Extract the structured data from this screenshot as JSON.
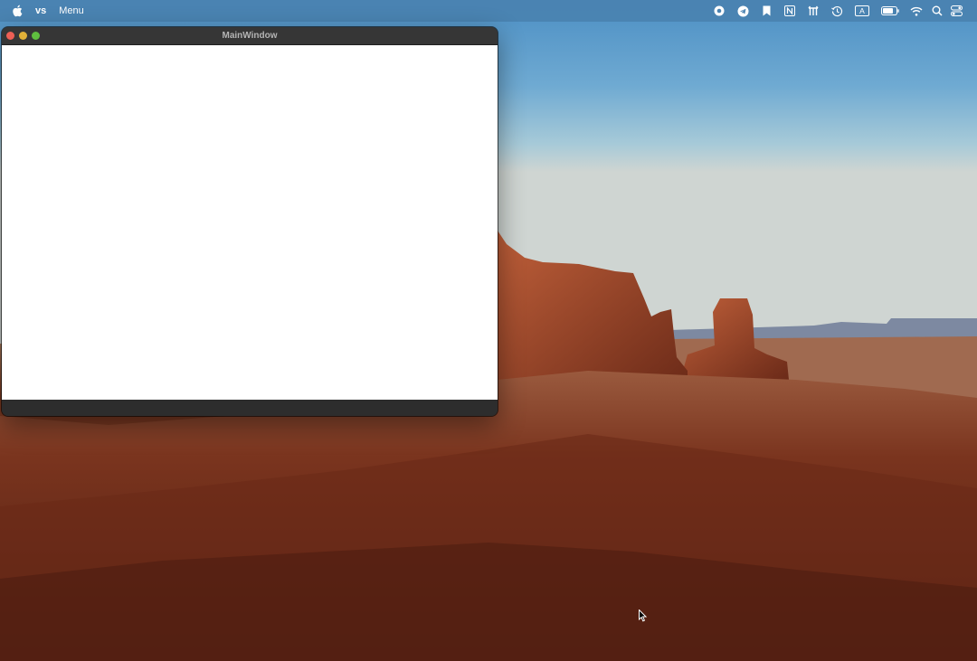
{
  "menubar": {
    "app_name": "vs",
    "menu_items": [
      "Menu"
    ],
    "status_icons": [
      "record-icon",
      "telegram-icon",
      "bookmark-icon",
      "notion-icon",
      "sync-icon",
      "time-machine-icon",
      "keyboard-input-icon",
      "battery-icon",
      "wifi-icon",
      "search-icon",
      "control-center-icon"
    ],
    "input_source_label": "A"
  },
  "window": {
    "title": "MainWindow"
  },
  "colors": {
    "menubar": "#4a82b0",
    "window_chrome": "#363636",
    "close": "#ed5f55",
    "minimize": "#e2b138",
    "maximize": "#5fbe3f"
  }
}
